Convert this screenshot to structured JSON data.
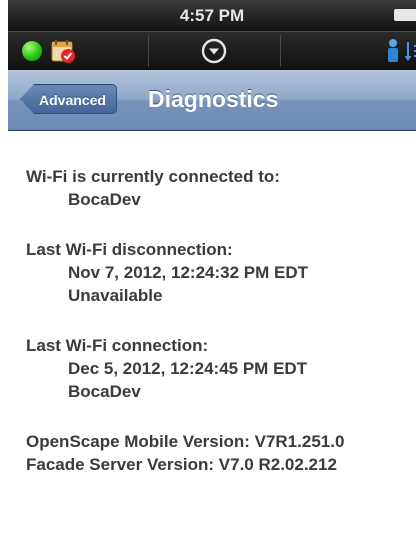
{
  "status_bar": {
    "time": "4:57 PM"
  },
  "toolbar": {
    "presence_icon": "green-presence-dot",
    "calendar_icon": "calendar-check-icon",
    "menu_icon": "chevron-down-circle-icon",
    "person_icon": "person-icon",
    "sort_icon": "sort-icon"
  },
  "nav": {
    "back_label": "Advanced",
    "title": "Diagnostics"
  },
  "diagnostics": {
    "wifi_connected_label": "Wi-Fi is currently connected to:",
    "wifi_connected_value": "BocaDev",
    "last_disconnect_label": "Last Wi-Fi disconnection:",
    "last_disconnect_time": "Nov 7, 2012, 12:24:32 PM EDT",
    "last_disconnect_network": "Unavailable",
    "last_connect_label": "Last Wi-Fi connection:",
    "last_connect_time": "Dec 5, 2012, 12:24:45 PM EDT",
    "last_connect_network": "BocaDev",
    "openscape_version": "OpenScape Mobile Version: V7R1.251.0",
    "facade_version": "Facade Server Version: V7.0 R2.02.212"
  },
  "colors": {
    "nav_bar": "#8ea7c8",
    "back_button": "#43659a",
    "presence": "#29c317",
    "text": "#3b3b3b"
  }
}
